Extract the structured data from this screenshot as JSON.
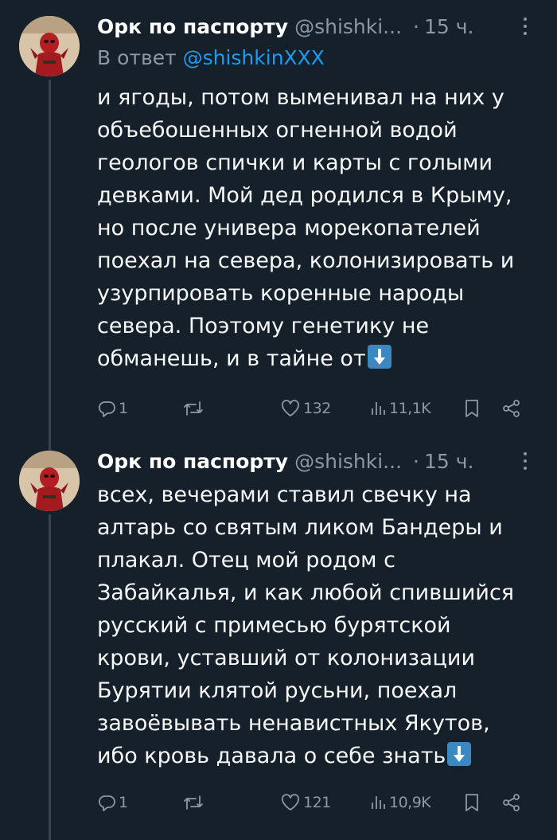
{
  "colors": {
    "background": "#15202b",
    "text": "#f7f9f9",
    "secondary": "#8b98a5",
    "link": "#1d9bf0",
    "thread_line": "#38444d"
  },
  "tweets": [
    {
      "display_name": "Орк по паспорту",
      "handle": "@shishki...",
      "dot": "·",
      "time": "15 ч.",
      "reply_prefix": "В ответ ",
      "reply_handle": "@shishkinXXX",
      "text": "и ягоды, потом выменивал на них у\nобъебошенных огненной водой\nгеологов спички и карты с голыми\nдевками. Мой дед родился в Крыму,\nно после универа морекопателей\nпоехал на севера, колонизировать и\nузурпировать коренные народы\nсевера. Поэтому генетику не\nобманешь, и в тайне от",
      "trailing_emoji": "down-arrow-emoji",
      "replies": "1",
      "retweets": "",
      "likes": "132",
      "views": "11,1K"
    },
    {
      "display_name": "Орк по паспорту",
      "handle": "@shishki...",
      "dot": "·",
      "time": "15 ч.",
      "text": "всех, вечерами ставил свечку на\nалтарь со святым ликом Бандеры и\nплакал. Отец мой родом с\nЗабайкалья, и как любой спившийся\nрусский с примесью бурятской\nкрови, уставший от колонизации\nБурятии клятой русьни, поехал\nзавоёвывать ненавистных Якутов,\nибо кровь давала о себе знать",
      "trailing_emoji": "down-arrow-emoji",
      "replies": "1",
      "retweets": "",
      "likes": "121",
      "views": "10,9K"
    }
  ],
  "icons": {
    "reply": "reply-icon",
    "retweet": "retweet-icon",
    "like": "heart-icon",
    "views": "views-chart-icon",
    "bookmark": "bookmark-icon",
    "share": "share-icon",
    "more": "more-dots-icon"
  }
}
